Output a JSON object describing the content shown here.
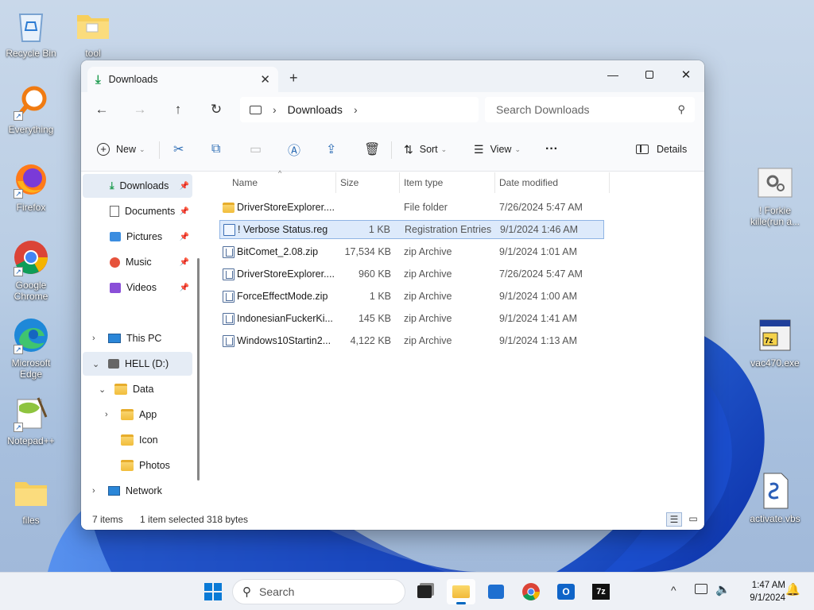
{
  "desktop": {
    "left_icons": [
      {
        "name": "recycle-bin",
        "label": "Recycle Bin"
      },
      {
        "name": "tool-folder",
        "label": "tool"
      },
      {
        "name": "everything",
        "label": "Everything"
      },
      {
        "name": "firefox",
        "label": "Firefox"
      },
      {
        "name": "google-chrome",
        "label": "Google Chrome"
      },
      {
        "name": "microsoft-edge",
        "label": "Microsoft Edge"
      },
      {
        "name": "notepad-plus-plus",
        "label": "Notepad++"
      },
      {
        "name": "files-folder",
        "label": "files"
      }
    ],
    "right_icons": [
      {
        "name": "forkie",
        "label": "! Forkie kille(run a..."
      },
      {
        "name": "vac470",
        "label": "vac470.exe"
      },
      {
        "name": "activate-vbs",
        "label": "activate.vbs"
      }
    ]
  },
  "explorer": {
    "tab_title": "Downloads",
    "new_tab_symbol": "+",
    "address": {
      "segment": "Downloads"
    },
    "search_placeholder": "Search Downloads",
    "toolbar": {
      "new": "New",
      "sort": "Sort",
      "view": "View",
      "more": "···",
      "details": "Details"
    },
    "sidebar": {
      "quick_access": [
        {
          "label": "Downloads",
          "icon": "download-icon"
        },
        {
          "label": "Documents",
          "icon": "documents-icon"
        },
        {
          "label": "Pictures",
          "icon": "pictures-icon"
        },
        {
          "label": "Music",
          "icon": "music-icon"
        },
        {
          "label": "Videos",
          "icon": "videos-icon"
        }
      ],
      "this_pc": "This PC",
      "drive": "HELL (D:)",
      "data_folder": "Data",
      "subfolders": [
        "App",
        "Icon",
        "Photos"
      ],
      "network": "Network"
    },
    "columns": {
      "name": "Name",
      "size": "Size",
      "type": "Item type",
      "date": "Date modified"
    },
    "files": [
      {
        "name": "DriverStoreExplorer....",
        "size": "",
        "type": "File folder",
        "date": "7/26/2024 5:47 AM",
        "kind": "folder"
      },
      {
        "name": "! Verbose Status.reg",
        "size": "1 KB",
        "type": "Registration Entries",
        "date": "9/1/2024 1:46 AM",
        "kind": "reg"
      },
      {
        "name": "BitComet_2.08.zip",
        "size": "17,534 KB",
        "type": "zip Archive",
        "date": "9/1/2024 1:01 AM",
        "kind": "zip"
      },
      {
        "name": "DriverStoreExplorer....",
        "size": "960 KB",
        "type": "zip Archive",
        "date": "7/26/2024 5:47 AM",
        "kind": "zip"
      },
      {
        "name": "ForceEffectMode.zip",
        "size": "1 KB",
        "type": "zip Archive",
        "date": "9/1/2024 1:00 AM",
        "kind": "zip"
      },
      {
        "name": "IndonesianFuckerKi...",
        "size": "145 KB",
        "type": "zip Archive",
        "date": "9/1/2024 1:41 AM",
        "kind": "zip"
      },
      {
        "name": "Windows10Startin2...",
        "size": "4,122 KB",
        "type": "zip Archive",
        "date": "9/1/2024 1:13 AM",
        "kind": "zip"
      }
    ],
    "status": {
      "count": "7 items",
      "selected": "1 item selected",
      "bytes": "318 bytes"
    }
  },
  "taskbar": {
    "search_placeholder": "Search",
    "time": "1:47 AM",
    "date": "9/1/2024"
  },
  "colors": {
    "accent": "#0067c0",
    "selection": "#ddeafb",
    "folder": "#f1bd3b"
  }
}
